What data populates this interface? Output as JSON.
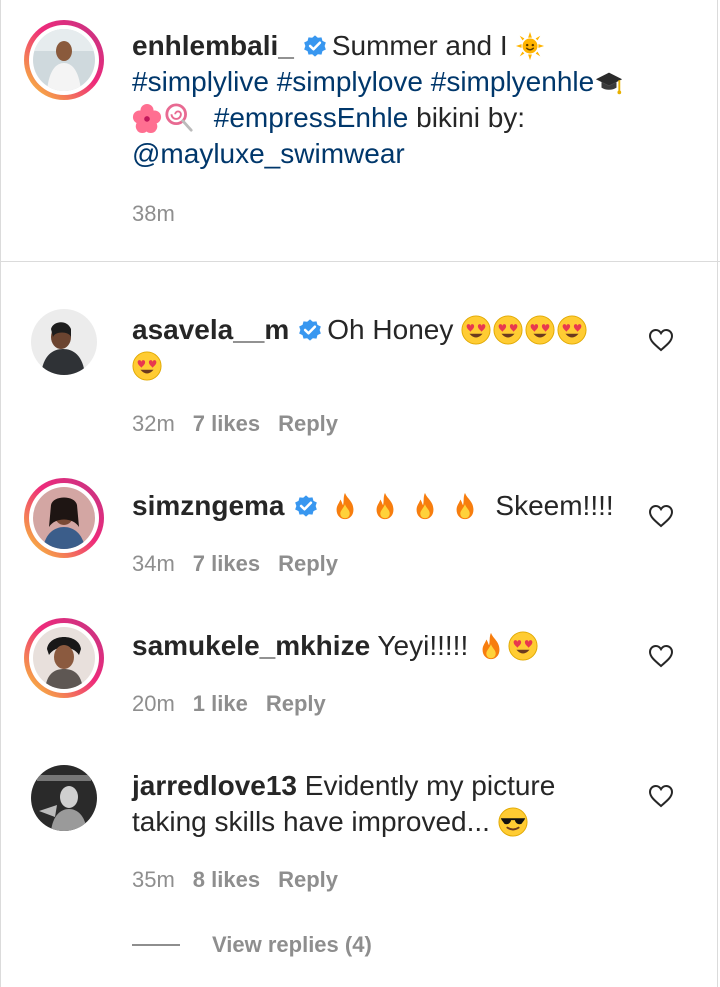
{
  "caption": {
    "username": "enhlembali_",
    "text_before": "Summer and I",
    "hashtags_line1": "#simplylive #simplylove #simplyenhle",
    "hashtag_line2": "#empressEnhle",
    "text_after": "bikini by:",
    "mention": "@mayluxe_swimwear",
    "time": "38m",
    "emojis": [
      "sun-with-face",
      "graduation-cap",
      "hibiscus",
      "lollipop"
    ]
  },
  "comments": [
    {
      "username": "asavela__m",
      "verified": true,
      "text": "Oh Honey",
      "emojis": [
        "heart-eyes",
        "heart-eyes",
        "heart-eyes",
        "heart-eyes",
        "heart-eyes"
      ],
      "time": "32m",
      "likes": "7 likes",
      "reply": "Reply"
    },
    {
      "username": "simzngema",
      "verified": true,
      "text": "Skeem!!!!",
      "emojis": [
        "fire",
        "fire",
        "fire",
        "fire"
      ],
      "time": "34m",
      "likes": "7 likes",
      "reply": "Reply"
    },
    {
      "username": "samukele_mkhize",
      "verified": false,
      "text": "Yeyi!!!!!",
      "emojis": [
        "fire",
        "heart-eyes"
      ],
      "time": "20m",
      "likes": "1 like",
      "reply": "Reply"
    },
    {
      "username": "jarredlove13",
      "verified": false,
      "text_line1": "Evidently my picture",
      "text_line2": "taking skills have improved...",
      "emojis": [
        "sunglasses-face"
      ],
      "time": "35m",
      "likes": "8 likes",
      "reply": "Reply"
    }
  ],
  "view_replies": "View replies (4)",
  "colors": {
    "hashtag": "#00376b",
    "meta": "#8e8e8e",
    "verified": "#3897f0"
  }
}
